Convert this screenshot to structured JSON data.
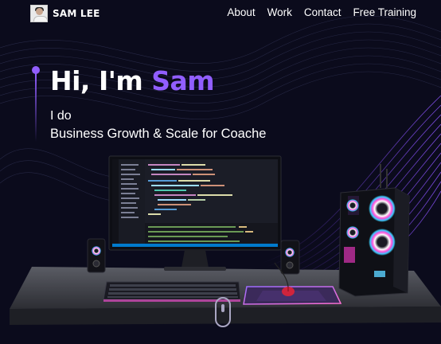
{
  "brand": {
    "name": "SAM LEE"
  },
  "nav": {
    "items": [
      "About",
      "Work",
      "Contact",
      "Free Training"
    ]
  },
  "hero": {
    "greeting": "Hi, I'm ",
    "name": "Sam",
    "line1": "I do",
    "line2": "Business Growth & Scale for Coache"
  },
  "colors": {
    "accent": "#915eff",
    "background": "#0b0b1c",
    "text": "#ffffff"
  },
  "icons": [
    "avatar",
    "desktop-monitor",
    "keyboard",
    "mouse",
    "speaker",
    "pc-tower",
    "scroll-mouse-icon"
  ]
}
